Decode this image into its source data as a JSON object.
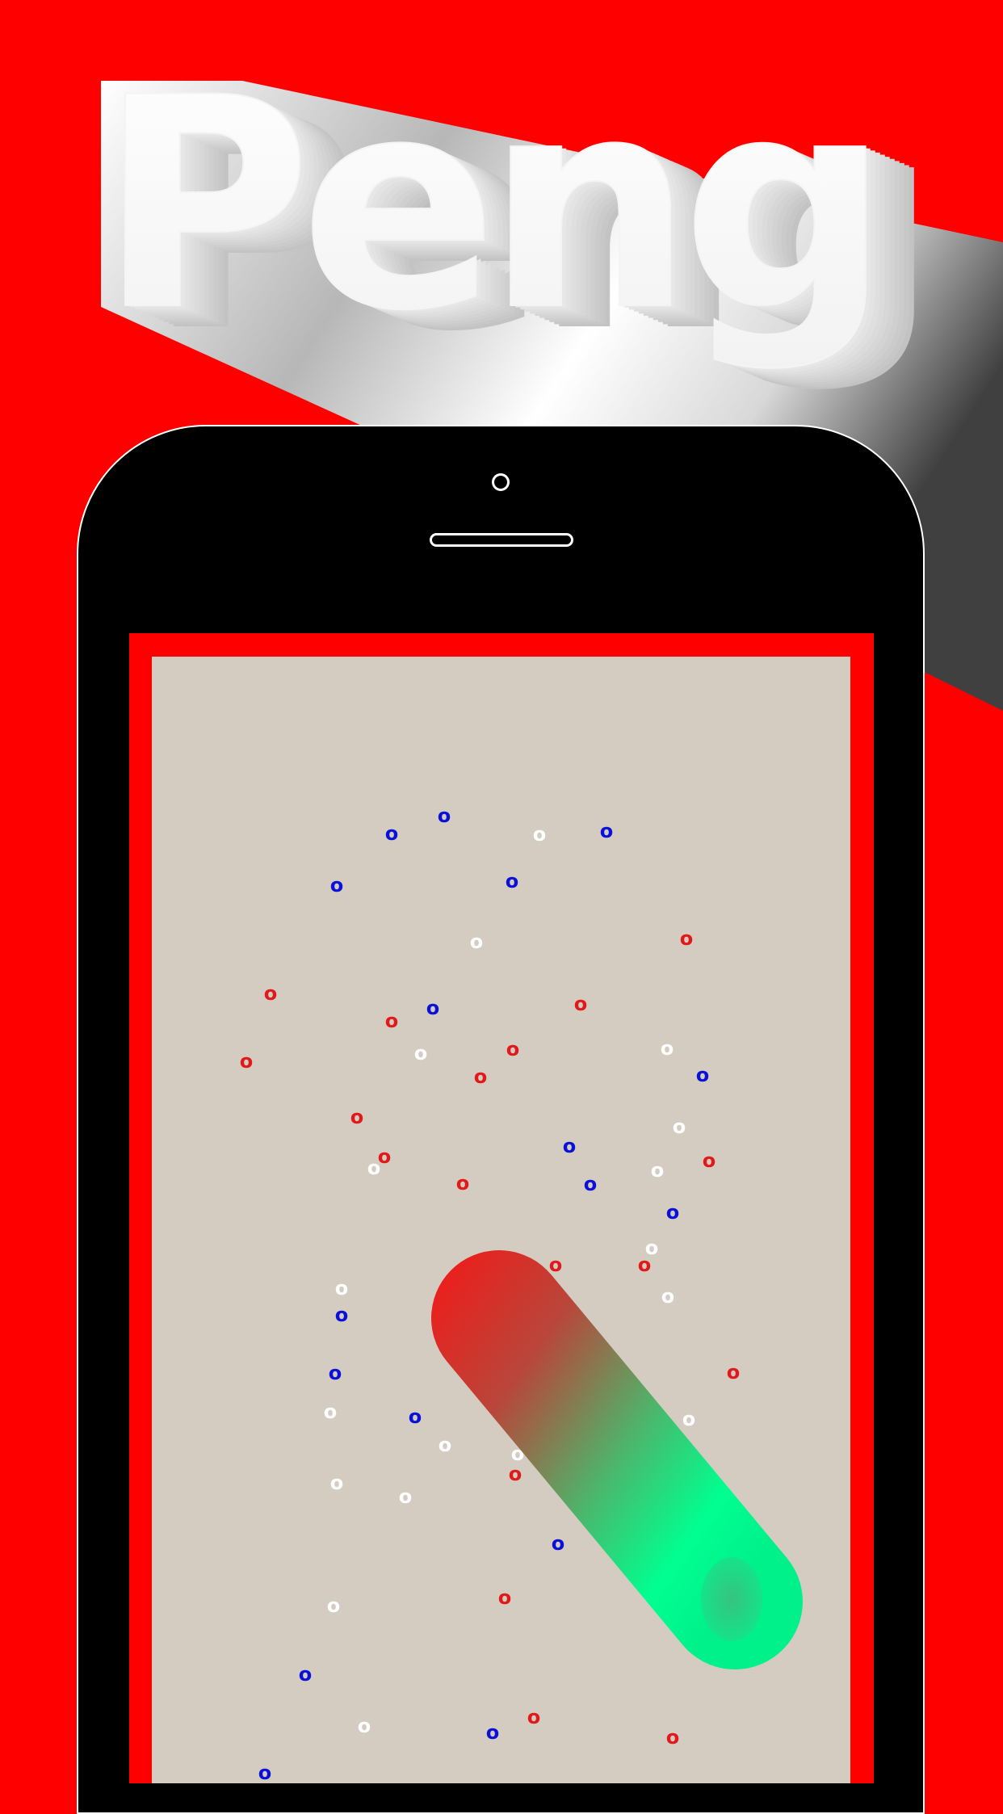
{
  "title": {
    "text": "Peng"
  },
  "colors": {
    "background": "#ff0000",
    "phone": "#000000",
    "screen_bg": "#d5ccc1",
    "dot_red": "#e0191b",
    "dot_blue": "#0a10d8",
    "dot_white": "#ffffff",
    "paddle_start": "#ff1010",
    "paddle_end": "#00ff90"
  },
  "phone": {
    "camera_icon": "camera-icon",
    "speaker_icon": "speaker-icon"
  },
  "game": {
    "dot_glyph": "o",
    "paddle": "gradient-paddle"
  }
}
